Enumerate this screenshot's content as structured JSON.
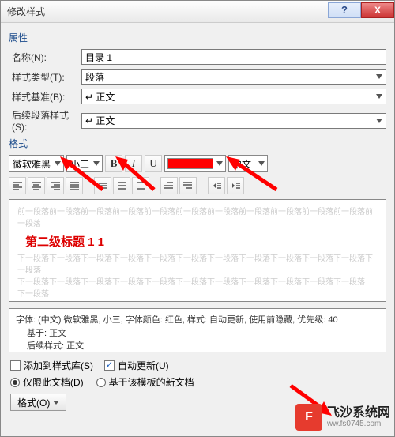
{
  "window": {
    "title": "修改样式",
    "help": "?",
    "close": "X"
  },
  "sections": {
    "properties": "属性",
    "format": "格式"
  },
  "labels": {
    "name": "名称(N):",
    "name_u": "N",
    "type": "样式类型(T):",
    "type_u": "T",
    "base": "样式基准(B):",
    "base_u": "B",
    "next": "后续段落样式(S):",
    "next_u": "S"
  },
  "values": {
    "name": "目录 1",
    "type": "段落",
    "base": "↵ 正文",
    "next": "↵ 正文",
    "font": "微软雅黑",
    "size": "小三",
    "lang": "中文",
    "color": "#ff0000"
  },
  "toolbar": {
    "bold": "B",
    "italic": "I",
    "underline": "U"
  },
  "preview": {
    "before": "前一段落前一段落前一段落前一段落前一段落前一段落前一段落前一段落前一段落前一段落前一段落前一段落",
    "title": "第二级标题 1 1",
    "after1": "下一段落下一段落下一段落下一段落下一段落下一段落下一段落下一段落下一段落下一段落下一段落下一段落",
    "after2": "下一段落下一段落下一段落下一段落下一段落下一段落下一段落下一段落下一段落下一段落下一段落",
    "after3": "下一段落"
  },
  "description": {
    "line1": "字体: (中文) 微软雅黑, 小三, 字体颜色: 红色, 样式: 自动更新, 使用前隐藏, 优先级: 40",
    "line2": "基于: 正文",
    "line3": "后续样式: 正文"
  },
  "options": {
    "addToLib": "添加到样式库(S)",
    "autoUpdate": "自动更新(U)",
    "thisDoc": "仅限此文档(D)",
    "templateDocs": "基于该模板的新文档"
  },
  "footer": {
    "formatBtn": "格式(O)"
  },
  "watermark": {
    "badge": "F",
    "line1": "飞沙系统网",
    "line2": "ww.fs0745.com"
  }
}
